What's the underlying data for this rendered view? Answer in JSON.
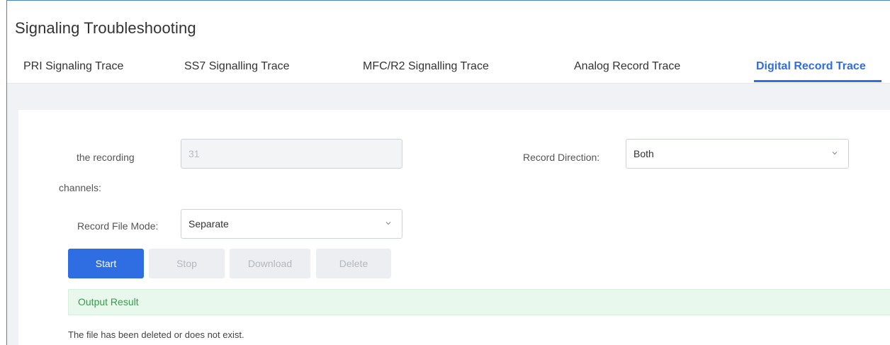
{
  "page": {
    "title": "Signaling Troubleshooting"
  },
  "tabs": [
    {
      "label": "PRI Signaling Trace",
      "active": false
    },
    {
      "label": "SS7 Signalling Trace",
      "active": false
    },
    {
      "label": "MFC/R2 Signalling Trace",
      "active": false
    },
    {
      "label": "Analog Record Trace",
      "active": false
    },
    {
      "label": "Digital Record Trace",
      "active": true
    }
  ],
  "form": {
    "recording_channels": {
      "label_line1": "the recording",
      "label_line2": "channels:",
      "value": "31"
    },
    "record_direction": {
      "label": "Record Direction:",
      "value": "Both"
    },
    "record_file_mode": {
      "label": "Record File Mode:",
      "value": "Separate"
    }
  },
  "buttons": {
    "start": "Start",
    "stop": "Stop",
    "download": "Download",
    "delete": "Delete"
  },
  "output": {
    "title": "Output Result",
    "message": "The file has been deleted or does not exist."
  },
  "colors": {
    "accent": "#2f6ee2",
    "success_bg": "#e9f8ec",
    "success_text": "#3a9a4c"
  }
}
